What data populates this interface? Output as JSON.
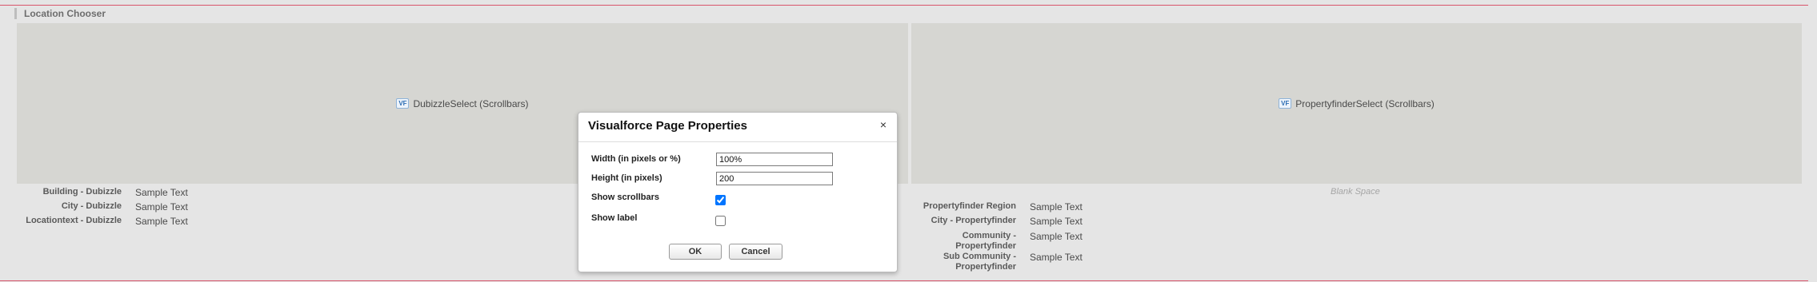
{
  "section": {
    "title": "Location Chooser"
  },
  "left_panel": {
    "component_label": "DubizzleSelect (Scrollbars)",
    "icon_text": "VF",
    "fields": [
      {
        "label": "Building - Dubizzle",
        "value": "Sample Text"
      },
      {
        "label": "City - Dubizzle",
        "value": "Sample Text"
      },
      {
        "label": "Locationtext - Dubizzle",
        "value": "Sample Text"
      }
    ]
  },
  "right_panel": {
    "component_label": "PropertyfinderSelect (Scrollbars)",
    "icon_text": "VF",
    "blank_space": "Blank Space",
    "fields": [
      {
        "label": "Propertyfinder Region",
        "value": "Sample Text"
      },
      {
        "label": "City - Propertyfinder",
        "value": "Sample Text"
      },
      {
        "label_line1": "Community -",
        "label_line2": "Propertyfinder",
        "value": "Sample Text"
      },
      {
        "label_line1": "Sub Community -",
        "label_line2": "Propertyfinder",
        "value": "Sample Text"
      }
    ]
  },
  "dialog": {
    "title": "Visualforce Page Properties",
    "close_glyph": "×",
    "width_label": "Width (in pixels or %)",
    "width_value": "100%",
    "height_label": "Height (in pixels)",
    "height_value": "200",
    "show_scrollbars_label": "Show scrollbars",
    "show_scrollbars_checked": true,
    "show_label_label": "Show label",
    "show_label_checked": false,
    "ok_label": "OK",
    "cancel_label": "Cancel"
  },
  "colors": {
    "accent_line": "#d9556b",
    "page_bg": "#e5e5e5",
    "placeholder_bg": "#d6d6d2"
  }
}
